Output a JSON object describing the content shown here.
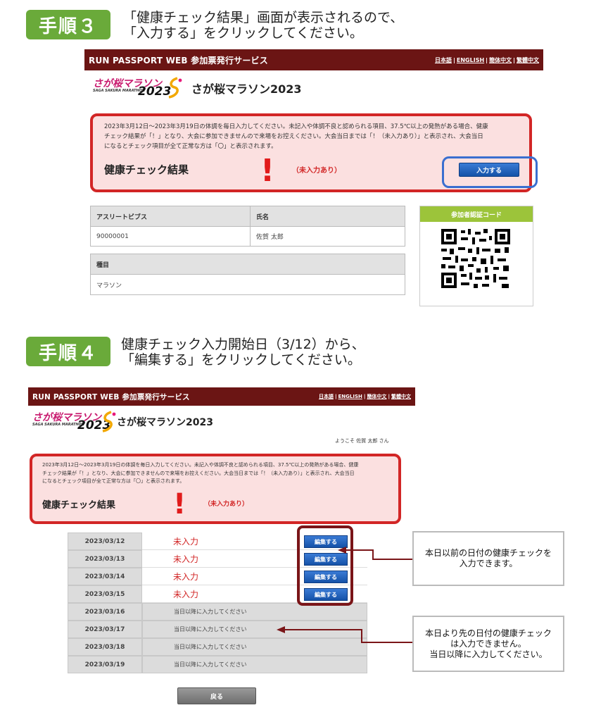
{
  "step3": {
    "badge": "手順３",
    "line1": "「健康チェック結果」画面が表示されるので、",
    "line2": "「入力する」をクリックしてください。"
  },
  "step4": {
    "badge": "手順４",
    "line1": "健康チェック入力開始日（3/12）から、",
    "line2": "「編集する」をクリックしてください。"
  },
  "header": {
    "brand": "RUN PASSPORT WEB  参加票発行サービス",
    "langs": [
      "日本語",
      "ENGLISH",
      "簡体中文",
      "繁體中文"
    ]
  },
  "logo": {
    "title_ja": "さが桜マラソン",
    "subtitle_en": "SAGA SAKURA MARATHON",
    "year": "2023",
    "event_name": "さが桜マラソン2023"
  },
  "welcome": "ようこそ 佐賀 太郎 さん",
  "health": {
    "note1": "2023年3月12日～2023年3月19日の体調を毎日入力してください。未記入や体調不良と認められる項目、37.5℃以上の発熱がある場合、健康",
    "note2": "チェック結果が「！」となり、大会に参加できませんので来場をお控えください。大会当日までは「！（未入力あり）」と表示され、大会当日",
    "note3": "になるとチェック項目が全て正常な方は「〇」と表示されます。",
    "title": "健康チェック結果",
    "mark": "!",
    "status": "（未入力あり）",
    "input_button": "入力する"
  },
  "athlete": {
    "bib_label": "アスリートビブス",
    "bib_value": "90000001",
    "name_label": "氏名",
    "name_value": "佐賀 太郎",
    "event_label": "種目",
    "event_value": "マラソン"
  },
  "qr_label": "参加者認証コード",
  "dates": [
    {
      "date": "2023/03/12",
      "status": "未入力",
      "editable": true
    },
    {
      "date": "2023/03/13",
      "status": "未入力",
      "editable": true
    },
    {
      "date": "2023/03/14",
      "status": "未入力",
      "editable": true
    },
    {
      "date": "2023/03/15",
      "status": "未入力",
      "editable": true
    },
    {
      "date": "2023/03/16",
      "status": "当日以降に入力してください",
      "editable": false
    },
    {
      "date": "2023/03/17",
      "status": "当日以降に入力してください",
      "editable": false
    },
    {
      "date": "2023/03/18",
      "status": "当日以降に入力してください",
      "editable": false
    },
    {
      "date": "2023/03/19",
      "status": "当日以降に入力してください",
      "editable": false
    }
  ],
  "edit_label": "編集する",
  "callout1": [
    "本日以前の日付の健康チェックを",
    "入力できます。"
  ],
  "callout2": [
    "本日より先の日付の健康チェック",
    "は入力できません。",
    "当日以降に入力してください。"
  ],
  "back_button": "戻る",
  "colors": {
    "header_bg": "#6b1514",
    "alert_border": "#d22626",
    "alert_bg": "#fbe0e0",
    "step_green": "#6aaa3a",
    "button_blue": "#1552a8",
    "qr_green": "#9cc43a"
  }
}
